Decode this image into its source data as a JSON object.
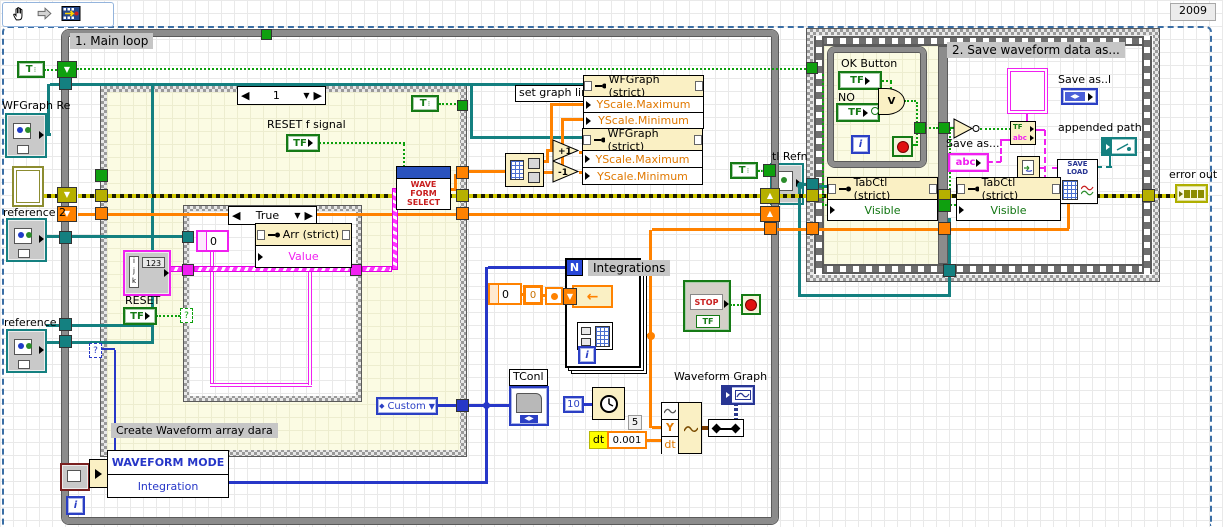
{
  "window": {
    "year": "2009"
  },
  "toolbar": {
    "icons": [
      "hand-tool",
      "forward-arrow-tool",
      "diagram-tool"
    ]
  },
  "glyphs": {
    "t": "T",
    "tf": "TF",
    "i": "i",
    "n": "N",
    "q": "?",
    "v": "V",
    "abc": "abc",
    "plus_one": "+1",
    "minus_one": "-1",
    "left_arrow": "◀",
    "right_arrow": "▶",
    "down_arrow": "▼",
    "up_arrow": "▲",
    "zero": "0",
    "ten": "10",
    "five": "5",
    "dt": "dt",
    "dt_value": "0.001",
    "custom": "Custom",
    "stop": "STOP",
    "y": "Y"
  },
  "main_loop": {
    "label": "1. Main loop"
  },
  "refs": {
    "wfgraph": "WFGraph Re",
    "reference2": "reference 2",
    "reference": "reference",
    "tabctl": "tl Refn"
  },
  "case_main": {
    "selector": "1",
    "footer_label": "Create Waveform array dara",
    "reset_signal_label": "RESET f signal",
    "reset_label": "RESET"
  },
  "case_inner": {
    "selector": "True",
    "prop_title": "Arr (strict)",
    "prop_row": "Value"
  },
  "reset_icon": {
    "rows": [
      "i",
      "j",
      "k"
    ],
    "badge": "123"
  },
  "wave_form_select": {
    "line1": "WAVE",
    "line2": "FORM",
    "line3": "SELECT"
  },
  "graph_limits": {
    "label": "set graph limi",
    "prop_title": "WFGraph (strict)",
    "row_max": "YScale.Maximum",
    "row_min": "YScale.Minimum"
  },
  "integrations": {
    "label": "Integrations"
  },
  "timing": {
    "tconl": "TConl"
  },
  "waveform_graph": {
    "label": "Waveform Graph"
  },
  "waveform_mode": {
    "row1": "WAVEFORM MODE",
    "row2": "Integration"
  },
  "save_frame": {
    "label": "2. Save waveform data as...",
    "ok_button": "OK Button",
    "no_label": "NO",
    "save_as_ring": "Save as..l",
    "appended_path": "appended path",
    "save_as": "Save as...",
    "saveload_line1": "SAVE",
    "saveload_line2": "LOAD",
    "tabctl_title": "TabCtl (strict)",
    "tabctl_row": "Visible",
    "error_out": "error out"
  },
  "colors": {
    "accent_teal": "#148080",
    "accent_orange": "#FF8200",
    "accent_green": "#0A7A0A",
    "accent_blue": "#2737C8",
    "accent_pink": "#FF20FF",
    "error_olive": "#B0A800",
    "structure_gray": "#8C8C8C",
    "diagram_yellow": "#FBFBE3"
  }
}
